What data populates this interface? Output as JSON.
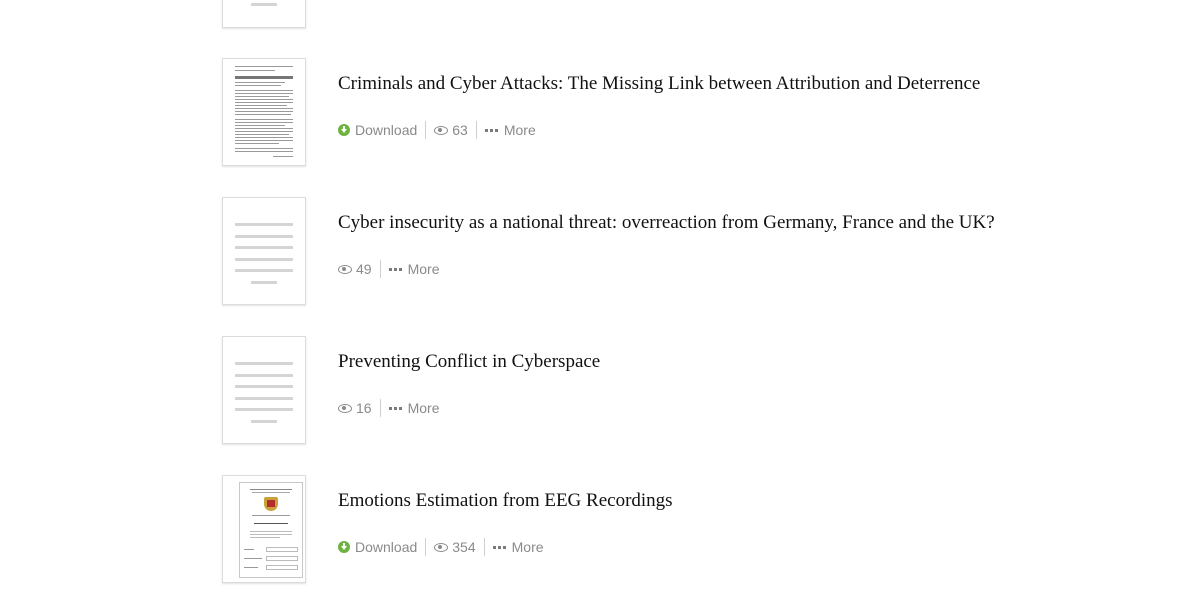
{
  "items": [
    {
      "title": "Criminals and Cyber Attacks: The Missing Link between Attribution and Deterrence",
      "download_label": "Download",
      "views": "63",
      "more_label": "More"
    },
    {
      "title": "Cyber insecurity as a national threat: overreaction from Germany, France and the UK?",
      "views": "49",
      "more_label": "More"
    },
    {
      "title": "Preventing Conflict in Cyberspace",
      "views": "16",
      "more_label": "More"
    },
    {
      "title": "Emotions Estimation from EEG Recordings",
      "download_label": "Download",
      "views": "354",
      "more_label": "More"
    }
  ],
  "colors": {
    "download_icon": "#6db33f",
    "meta_text": "#8a8a8a"
  }
}
